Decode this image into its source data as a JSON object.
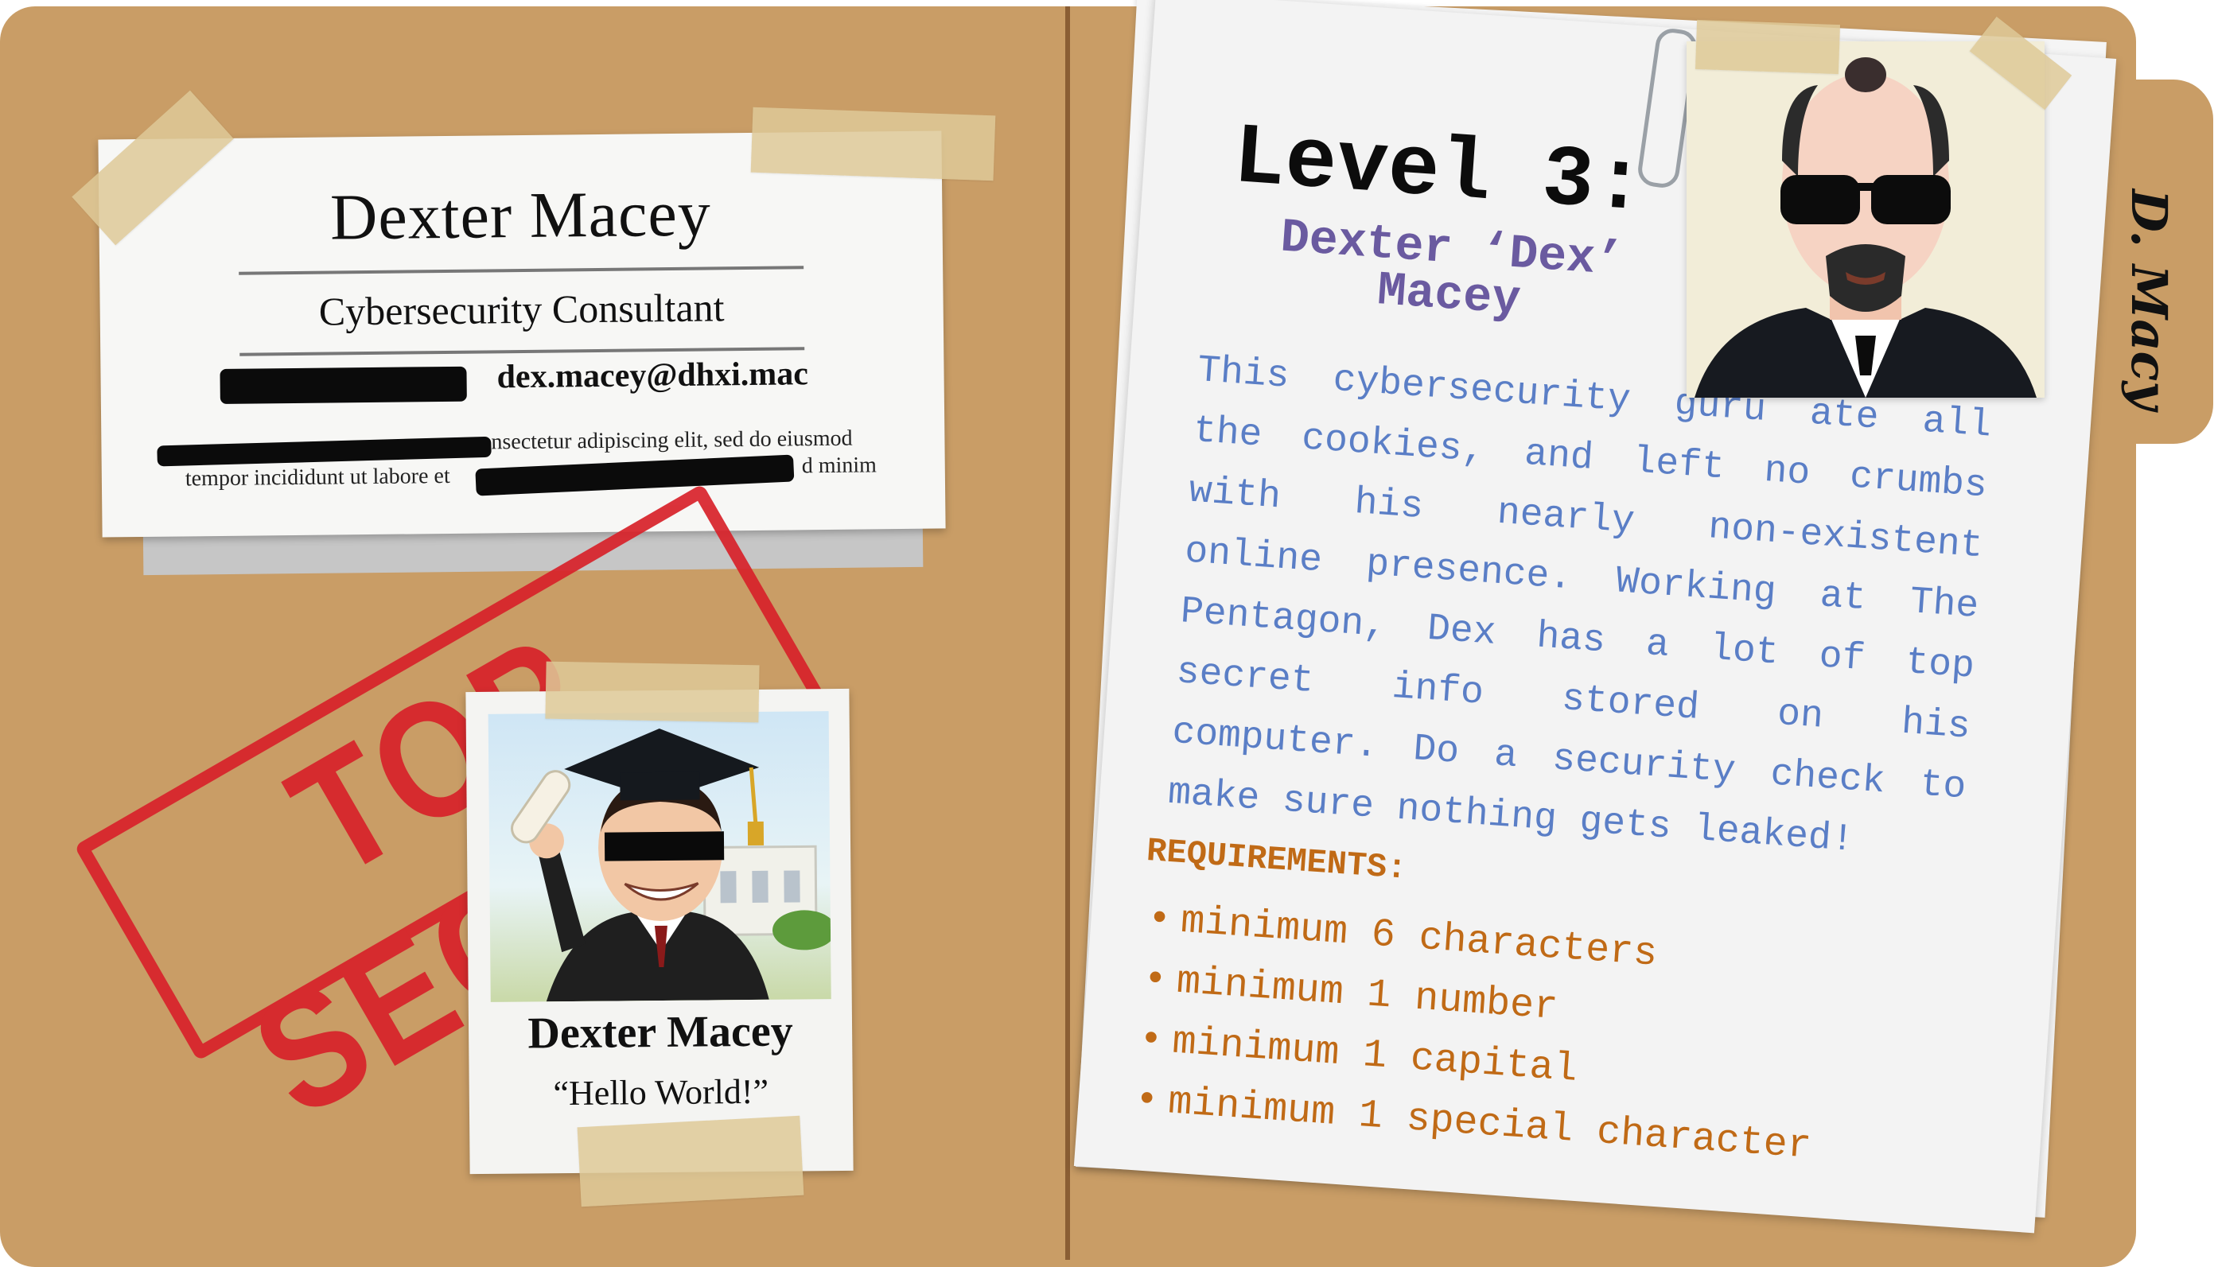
{
  "folder": {
    "tab_label": "D. Macy",
    "color": "#c99d66"
  },
  "id_card": {
    "name": "Dexter Macey",
    "title": "Cybersecurity Consultant",
    "email": "dex.macey@dhxi.mac",
    "lorem_line1": "nsectetur adipiscing elit, sed do eiusmod",
    "lorem_line2_left": "tempor incididunt ut labore et",
    "lorem_line2_right": "d minim"
  },
  "stamp": {
    "text": "TOP SECRET",
    "color": "#d8222a"
  },
  "polaroid": {
    "name": "Dexter Macey",
    "quote": "“Hello World!”"
  },
  "profile": {
    "level": "Level 3:",
    "name_line1": "Dexter ‘Dex’",
    "name_line2": "Macey",
    "bio": "This cybersecurity guru ate all the cookies, and left no crumbs with his nearly non-existent online presence. Working at The Pentagon, Dex has a lot of top secret info stored on his computer. Do a security check to make sure nothing gets leaked!",
    "requirements_title": "REQUIREMENTS:",
    "requirements": [
      "minimum 6 characters",
      "minimum 1 number",
      "minimum 1 capital",
      "minimum 1 special character"
    ],
    "bio_color": "#5a7ec6",
    "name_color": "#6a5aa0",
    "requirements_color": "#c06a16"
  }
}
